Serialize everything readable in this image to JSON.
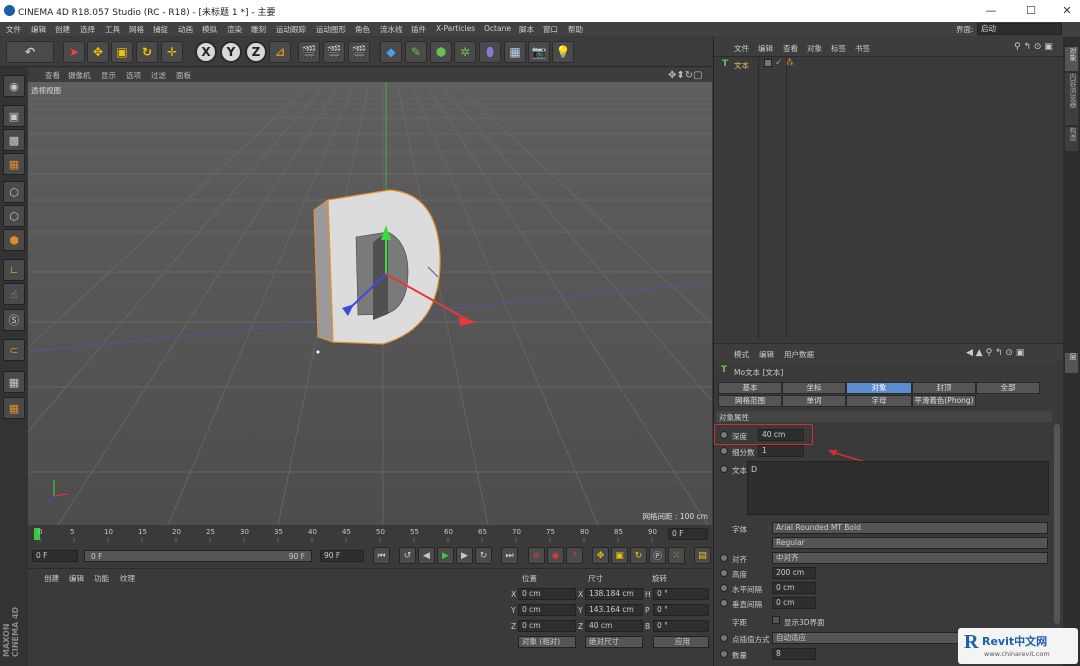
{
  "window": {
    "title": "CINEMA 4D R18.057 Studio (RC - R18) - [未标题 1 *] - 主要",
    "minimize": "—",
    "maximize": "☐",
    "close": "✕"
  },
  "menu": [
    "文件",
    "编辑",
    "创建",
    "选择",
    "工具",
    "网格",
    "捕捉",
    "动画",
    "模拟",
    "渲染",
    "雕刻",
    "运动跟踪",
    "运动图形",
    "角色",
    "流水线",
    "插件",
    "X-Particles",
    "Octane",
    "脚本",
    "窗口",
    "帮助"
  ],
  "layout": {
    "label": "界面:",
    "value": "启动"
  },
  "viewport": {
    "menu": [
      "查看",
      "摄像机",
      "显示",
      "选项",
      "过滤",
      "面板"
    ],
    "label": "透视视图",
    "grid_distance": "网格间距 : 100 cm"
  },
  "timeline": {
    "ticks": [
      "0",
      "5",
      "10",
      "15",
      "20",
      "25",
      "30",
      "35",
      "40",
      "45",
      "50",
      "55",
      "60",
      "65",
      "70",
      "75",
      "80",
      "85",
      "90"
    ],
    "end_frame": "0 F"
  },
  "playback": {
    "current": "0 F",
    "start": "0 F",
    "end_mark": "90 F",
    "end": "90 F"
  },
  "material_menu": [
    "创建",
    "编辑",
    "功能",
    "纹理"
  ],
  "coords": {
    "headers": [
      "位置",
      "尺寸",
      "旋转"
    ],
    "rows": [
      {
        "axis": "X",
        "pos": "0 cm",
        "size_axis": "X",
        "size": "138.184 cm",
        "rot_axis": "H",
        "rot": "0 °"
      },
      {
        "axis": "Y",
        "pos": "0 cm",
        "size_axis": "Y",
        "size": "143.164 cm",
        "rot_axis": "P",
        "rot": "0 °"
      },
      {
        "axis": "Z",
        "pos": "0 cm",
        "size_axis": "Z",
        "size": "40 cm",
        "rot_axis": "B",
        "rot": "0 °"
      }
    ],
    "mode": "对象 (相对)",
    "size_mode": "绝对尺寸",
    "apply": "应用"
  },
  "objects": {
    "menu": [
      "文件",
      "编辑",
      "查看",
      "对象",
      "标签",
      "书签"
    ],
    "items": [
      {
        "name": "文本"
      }
    ]
  },
  "attributes": {
    "menu": [
      "模式",
      "编辑",
      "用户数据"
    ],
    "title": "Mo文本 [文本]",
    "tabs_row1": [
      "基本",
      "坐标",
      "对象",
      "封顶",
      "全部"
    ],
    "tabs_row2": [
      "网格范围",
      "单词",
      "字母",
      "平滑着色(Phong)"
    ],
    "active_tab": "对象",
    "section": "对象属性",
    "depth_label": "深度",
    "depth_value": "40 cm",
    "subdiv_label": "细分数",
    "subdiv_value": "1",
    "text_label": "文本",
    "text_value": "D",
    "font_label": "字体",
    "font_value": "Arial Rounded MT Bold",
    "font_style": "Regular",
    "align_label": "对齐",
    "align_value": "中对齐",
    "height_label": "高度",
    "height_value": "200 cm",
    "hspace_label": "水平间隔",
    "hspace_value": "0 cm",
    "vspace_label": "垂直间隔",
    "vspace_value": "0 cm",
    "kerning_label": "字距",
    "show3d_label": "显示3D界面",
    "interp_label": "点插值方式",
    "interp_value": "自动适应",
    "count_label": "数量",
    "count_value": "8"
  },
  "side_tabs": [
    "对象",
    "内容浏览器",
    "构造",
    "层"
  ],
  "watermark": {
    "brand": "Revit中文网",
    "url": "www.chinarevit.com"
  },
  "colors": {
    "accent": "#5b8ed0",
    "highlight_box": "#d03030",
    "arrow": "#d03030",
    "object_outline": "#e8912a"
  }
}
